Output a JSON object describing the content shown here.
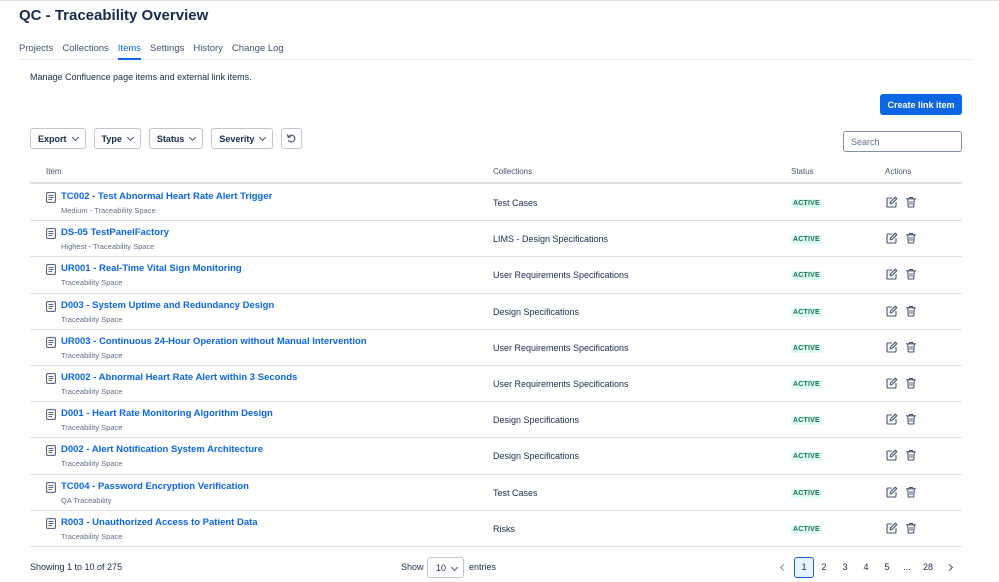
{
  "page": {
    "title": "QC - Traceability Overview",
    "description": "Manage Confluence page items and external link items."
  },
  "tabs": [
    {
      "label": "Projects"
    },
    {
      "label": "Collections"
    },
    {
      "label": "Items",
      "active": true
    },
    {
      "label": "Settings"
    },
    {
      "label": "History"
    },
    {
      "label": "Change Log"
    }
  ],
  "toolbar": {
    "create_label": "Create link item",
    "filters": [
      "Export",
      "Type",
      "Status",
      "Severity"
    ],
    "search_placeholder": "Search"
  },
  "table": {
    "headers": {
      "item": "Item",
      "collections": "Collections",
      "status": "Status",
      "actions": "Actions"
    },
    "rows": [
      {
        "title": "TC002 - Test Abnormal Heart Rate Alert Trigger",
        "sub": "Medium - Traceability Space",
        "collection": "Test Cases",
        "status": "ACTIVE"
      },
      {
        "title": "DS-05 TestPanelFactory",
        "sub": "Highest - Traceability Space",
        "collection": "LIMS - Design Specifications",
        "status": "ACTIVE"
      },
      {
        "title": "UR001 - Real-Time Vital Sign Monitoring",
        "sub": "Traceability Space",
        "collection": "User Requirements Specifications",
        "status": "ACTIVE"
      },
      {
        "title": "D003 - System Uptime and Redundancy Design",
        "sub": "Traceability Space",
        "collection": "Design Specifications",
        "status": "ACTIVE"
      },
      {
        "title": "UR003 - Continuous 24-Hour Operation without Manual Intervention",
        "sub": "Traceability Space",
        "collection": "User Requirements Specifications",
        "status": "ACTIVE"
      },
      {
        "title": "UR002 - Abnormal Heart Rate Alert within 3 Seconds",
        "sub": "Traceability Space",
        "collection": "User Requirements Specifications",
        "status": "ACTIVE"
      },
      {
        "title": "D001 - Heart Rate Monitoring Algorithm Design",
        "sub": "Traceability Space",
        "collection": "Design Specifications",
        "status": "ACTIVE"
      },
      {
        "title": "D002 - Alert Notification System Architecture",
        "sub": "Traceability Space",
        "collection": "Design Specifications",
        "status": "ACTIVE"
      },
      {
        "title": "TC004 - Password Encryption Verification",
        "sub": "QA Traceability",
        "collection": "Test Cases",
        "status": "ACTIVE"
      },
      {
        "title": "R003 - Unauthorized Access to Patient Data",
        "sub": "Traceability Space",
        "collection": "Risks",
        "status": "ACTIVE"
      }
    ]
  },
  "footer": {
    "showing": "Showing 1 to 10 of 275",
    "show_label": "Show",
    "page_size": "10",
    "entries_label": "entries",
    "pages": [
      "1",
      "2",
      "3",
      "4",
      "5",
      "...",
      "28"
    ],
    "current_page": "1"
  },
  "colors": {
    "accent": "#0c66e4",
    "status_bg": "#dcfff1",
    "status_text": "#216e4e"
  },
  "icons": {
    "row": "document-icon",
    "edit": "edit-icon",
    "delete": "trash-icon",
    "refresh": "refresh-icon"
  }
}
